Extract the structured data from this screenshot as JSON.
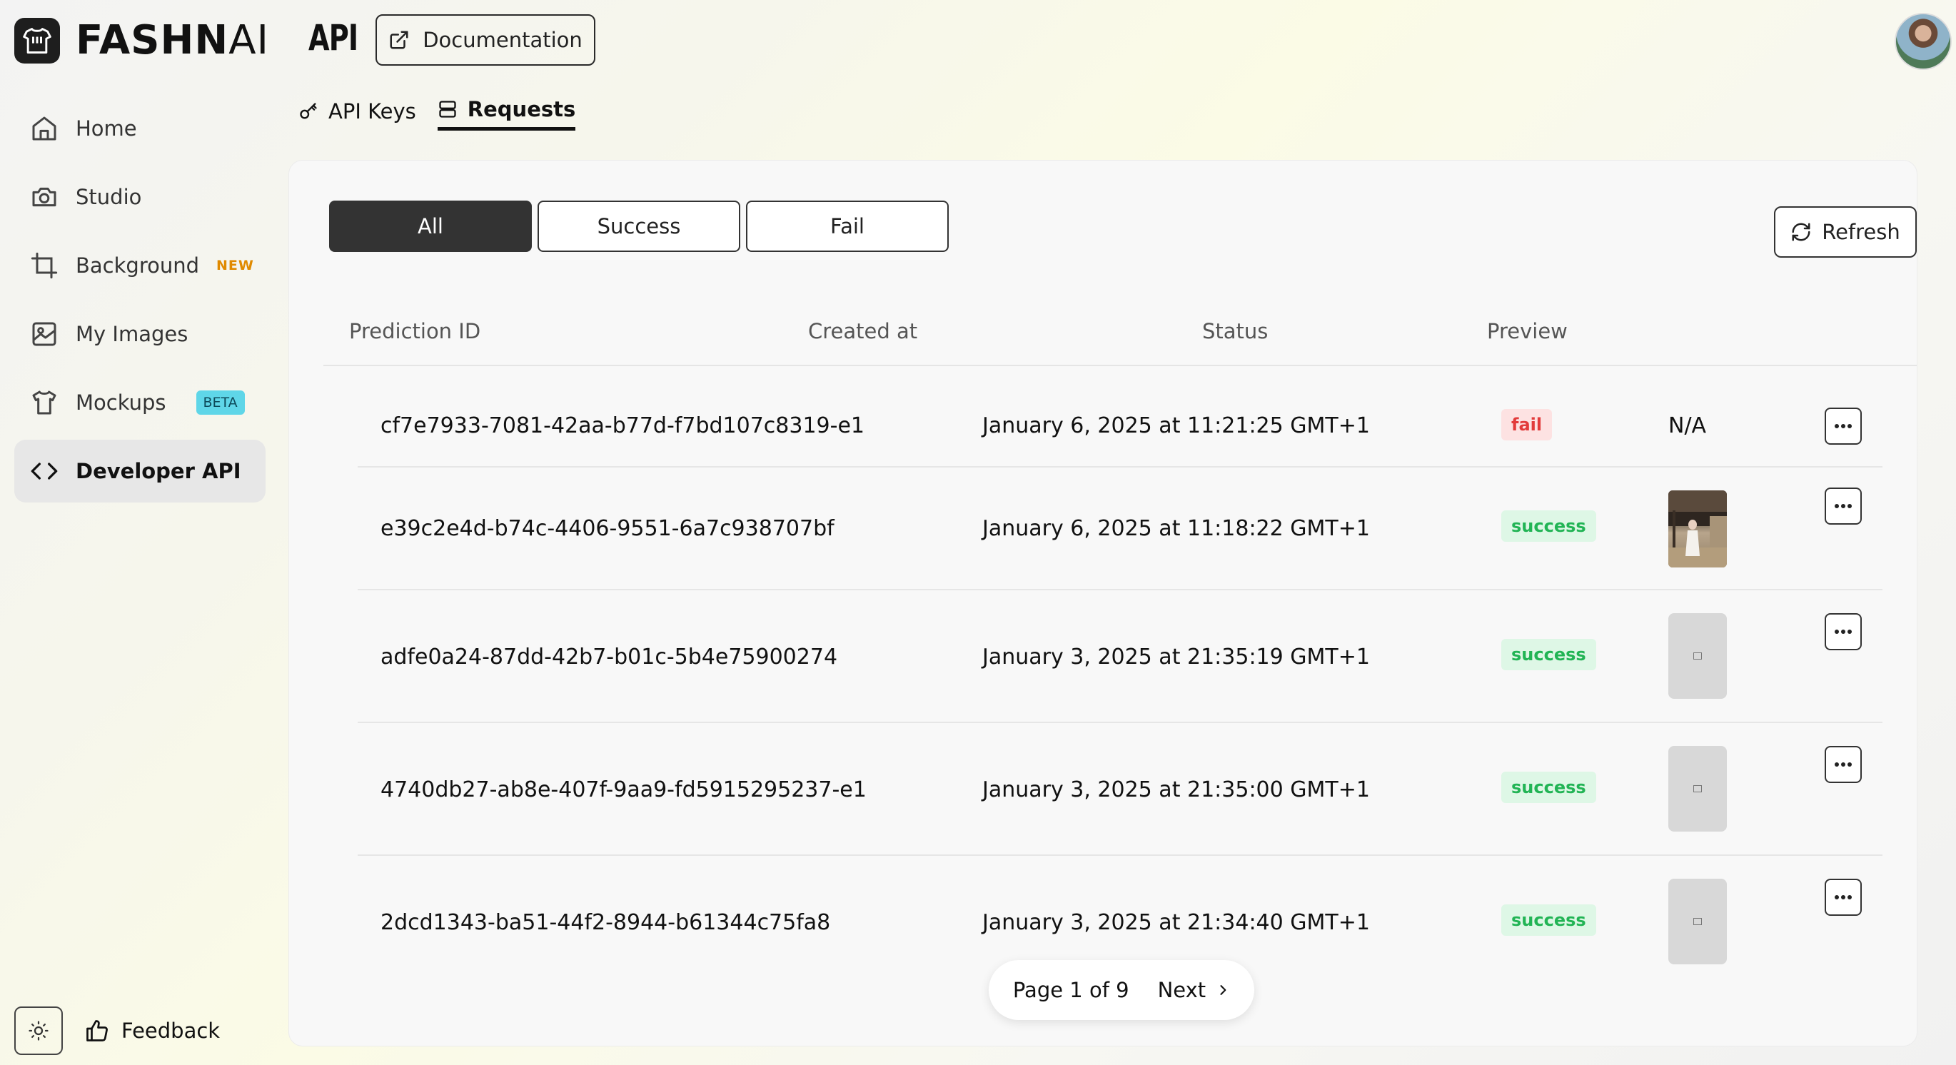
{
  "app": {
    "logo_text_bold": "FASHN",
    "logo_text_thin": "AI",
    "page_title": "API",
    "documentation_label": "Documentation"
  },
  "subtabs": [
    {
      "label": "API Keys",
      "icon": "key-icon"
    },
    {
      "label": "Requests",
      "icon": "database-icon",
      "active": true
    }
  ],
  "sidebar": {
    "items": [
      {
        "label": "Home",
        "icon": "home-icon"
      },
      {
        "label": "Studio",
        "icon": "camera-icon"
      },
      {
        "label": "Background",
        "icon": "crop-icon",
        "badge": "NEW"
      },
      {
        "label": "My Images",
        "icon": "image-icon"
      },
      {
        "label": "Mockups",
        "icon": "shirt-icon",
        "badge": "BETA"
      },
      {
        "label": "Developer API",
        "icon": "code-icon",
        "active": true
      }
    ],
    "feedback_label": "Feedback"
  },
  "filters": {
    "all": "All",
    "success": "Success",
    "fail": "Fail",
    "selected": "All"
  },
  "refresh_label": "Refresh",
  "table": {
    "columns": {
      "id": "Prediction ID",
      "created": "Created at",
      "status": "Status",
      "preview": "Preview"
    },
    "rows": [
      {
        "id": "cf7e7933-7081-42aa-b77d-f7bd107c8319-e1",
        "created": "January 6, 2025 at 11:21:25 GMT+1",
        "status": "fail",
        "preview": "N/A"
      },
      {
        "id": "e39c2e4d-b74c-4406-9551-6a7c938707bf",
        "created": "January 6, 2025 at 11:18:22 GMT+1",
        "status": "success",
        "preview": "image"
      },
      {
        "id": "adfe0a24-87dd-42b7-b01c-5b4e75900274",
        "created": "January 3, 2025 at 21:35:19 GMT+1",
        "status": "success",
        "preview": "placeholder"
      },
      {
        "id": "4740db27-ab8e-407f-9aa9-fd5915295237-e1",
        "created": "January 3, 2025 at 21:35:00 GMT+1",
        "status": "success",
        "preview": "placeholder"
      },
      {
        "id": "2dcd1343-ba51-44f2-8944-b61344c75fa8",
        "created": "January 3, 2025 at 21:34:40 GMT+1",
        "status": "success",
        "preview": "placeholder"
      }
    ]
  },
  "pagination": {
    "page_text": "Page 1 of 9",
    "next_label": "Next"
  },
  "colors": {
    "fail_bg": "#fde2e2",
    "fail_text": "#e23b3b",
    "success_bg": "#def7e6",
    "success_text": "#22b455",
    "new_badge": "#e08a00",
    "beta_badge": "#5fd6e8"
  }
}
